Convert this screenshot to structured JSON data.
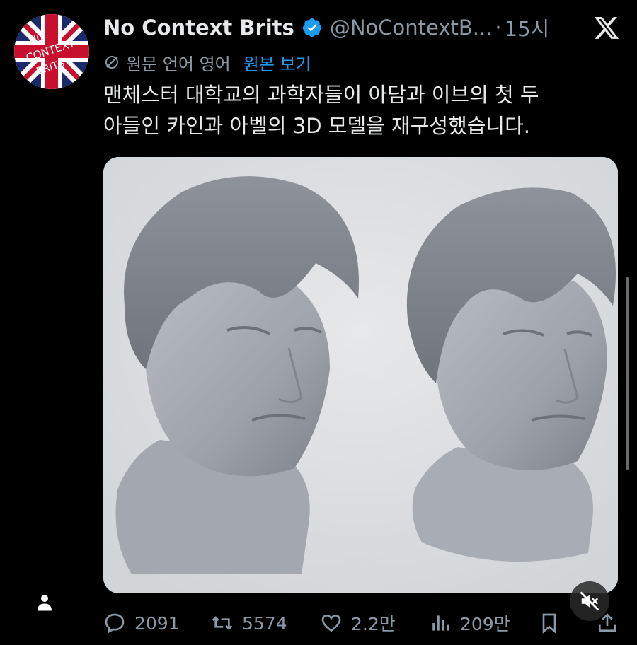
{
  "author": {
    "name": "No Context Brits",
    "handle": "@NoContextB...",
    "separator": "·",
    "time": "15시",
    "verified": true,
    "avatar_text": "NO CONTEXT BRITS"
  },
  "translation": {
    "label": "원문 언어 영어",
    "link": "원본 보기"
  },
  "tweet": {
    "lines": [
      "맨체스터 대학교의 과학자들이 아담과 이브의 첫 두",
      "아들인 카인과 아벨의 3D 모델을 재구성했습니다."
    ]
  },
  "media": {
    "description_icon": "two-3d-head-models-image"
  },
  "actions": {
    "replies": "2091",
    "retweets": "5574",
    "likes": "2.2만",
    "views": "209만"
  },
  "colors": {
    "background": "#000000",
    "text": "#e7e9ea",
    "muted": "#8b98a5",
    "link": "#1d9bf0",
    "verified": "#1d9bf0"
  },
  "icons": [
    "x-logo-icon",
    "verified-badge-icon",
    "translate-icon",
    "reply-icon",
    "retweet-icon",
    "like-icon",
    "views-icon",
    "bookmark-icon",
    "share-icon",
    "mute-icon",
    "profile-icon"
  ]
}
